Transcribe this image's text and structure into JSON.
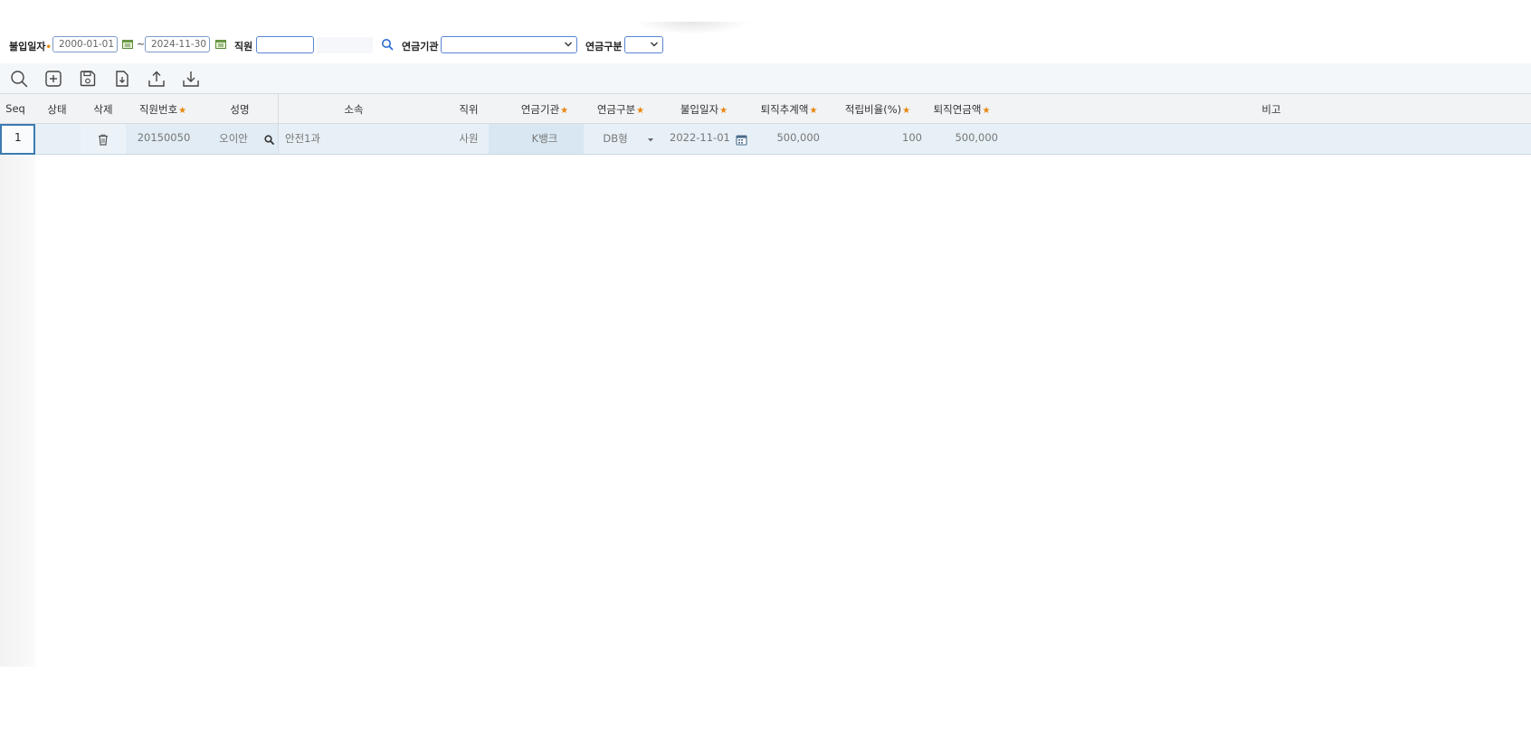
{
  "search": {
    "date_label": "불입일자",
    "date_from": "2000-01-01",
    "tilde": "~",
    "date_to": "2024-11-30",
    "employee_label": "직원",
    "employee_value": "",
    "institution_label": "연금기관",
    "institution_value": "",
    "type_label": "연금구분",
    "type_value": ""
  },
  "toolbar": {
    "buttons": [
      "search-icon",
      "add-icon",
      "save-icon",
      "export-file-icon",
      "upload-icon",
      "download-icon"
    ]
  },
  "grid": {
    "columns": [
      {
        "label": "Seq",
        "required": false
      },
      {
        "label": "상태",
        "required": false
      },
      {
        "label": "삭제",
        "required": false
      },
      {
        "label": "직원번호",
        "required": true
      },
      {
        "label": "성명",
        "required": false
      },
      {
        "label": "소속",
        "required": false
      },
      {
        "label": "직위",
        "required": false
      },
      {
        "label": "연금기관",
        "required": true
      },
      {
        "label": "연금구분",
        "required": true
      },
      {
        "label": "불입일자",
        "required": true
      },
      {
        "label": "퇴직추계액",
        "required": true
      },
      {
        "label": "적립비율(%)",
        "required": true
      },
      {
        "label": "퇴직연금액",
        "required": true
      },
      {
        "label": "비고",
        "required": false
      }
    ],
    "rows": [
      {
        "seq": "1",
        "status": "",
        "emp_no": "20150050",
        "name": "오이안",
        "dept": "안전1과",
        "position": "사원",
        "institution": "K뱅크",
        "pension_type": "DB형",
        "pay_date": "2022-11-01",
        "estimate": "500,000",
        "ratio": "100",
        "pension_amount": "500,000",
        "note": ""
      }
    ]
  },
  "colors": {
    "required_star": "#e8860b",
    "input_border": "#5a86d4",
    "row_selected": "#e7f0f6",
    "focus_border": "#3b7bb0"
  }
}
